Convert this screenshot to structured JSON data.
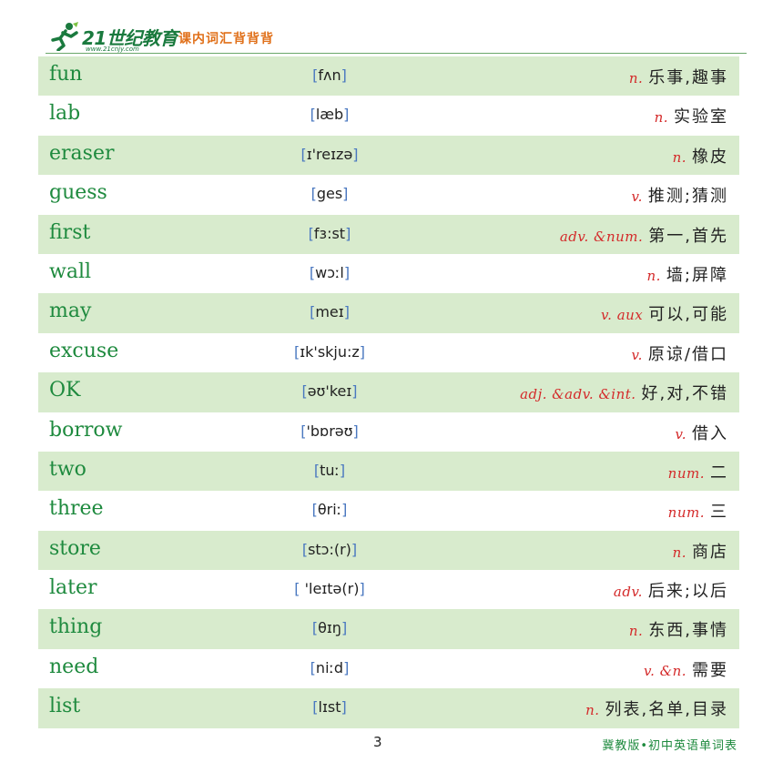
{
  "header": {
    "logo_main": "21世纪教育",
    "logo_sub": "www.21cnjy.com",
    "title": "课内词汇背背背"
  },
  "rows": [
    {
      "word": "fun",
      "phonetic": "fʌn",
      "pos": "n.",
      "meaning": "乐事,趣事"
    },
    {
      "word": "lab",
      "phonetic": "læb",
      "pos": "n.",
      "meaning": "实验室"
    },
    {
      "word": "eraser",
      "phonetic": "ɪ'reɪzə",
      "pos": "n.",
      "meaning": "橡皮"
    },
    {
      "word": "guess",
      "phonetic": "ges",
      "pos": "v.",
      "meaning": "推测;猜测"
    },
    {
      "word": "first",
      "phonetic": "fɜ:st",
      "pos": "adv. &num.",
      "meaning": "第一,首先"
    },
    {
      "word": "wall",
      "phonetic": "wɔːl",
      "pos": "n.",
      "meaning": "墙;屏障"
    },
    {
      "word": "may",
      "phonetic": "meɪ",
      "pos": "v. aux",
      "meaning": "可以,可能"
    },
    {
      "word": "excuse",
      "phonetic": "ɪk'skju:z",
      "pos": "v.",
      "meaning": "原谅/借口"
    },
    {
      "word": "OK",
      "phonetic": "əʊ'keɪ",
      "pos": "adj. &adv. &int.",
      "meaning": "好,对,不错"
    },
    {
      "word": "borrow",
      "phonetic": "'bɒrəʊ",
      "pos": "v.",
      "meaning": "借入"
    },
    {
      "word": "two",
      "phonetic": "tuː",
      "pos": "num.",
      "meaning": "二"
    },
    {
      "word": "three",
      "phonetic": "θriː",
      "pos": "num.",
      "meaning": "三"
    },
    {
      "word": "store",
      "phonetic": "stɔ:(r)",
      "pos": "n.",
      "meaning": "商店"
    },
    {
      "word": "later",
      "phonetic": " 'leɪtə(r)",
      "pos": "adv.",
      "meaning": "后来;以后"
    },
    {
      "word": "thing",
      "phonetic": "θɪŋ",
      "pos": "n.",
      "meaning": "东西,事情"
    },
    {
      "word": "need",
      "phonetic": "niːd",
      "pos": "v. &n.",
      "meaning": "需要"
    },
    {
      "word": "list",
      "phonetic": "lɪst",
      "pos": "n.",
      "meaning": "列表,名单,目录"
    }
  ],
  "footer": {
    "page_number": "3",
    "book_title": "冀教版•初中英语单词表"
  },
  "colors": {
    "word": "#1e8a3e",
    "pos": "#d42a2a",
    "shade": "#d8ebcd",
    "brand": "#1a7a3e",
    "header_title": "#e0701a"
  }
}
